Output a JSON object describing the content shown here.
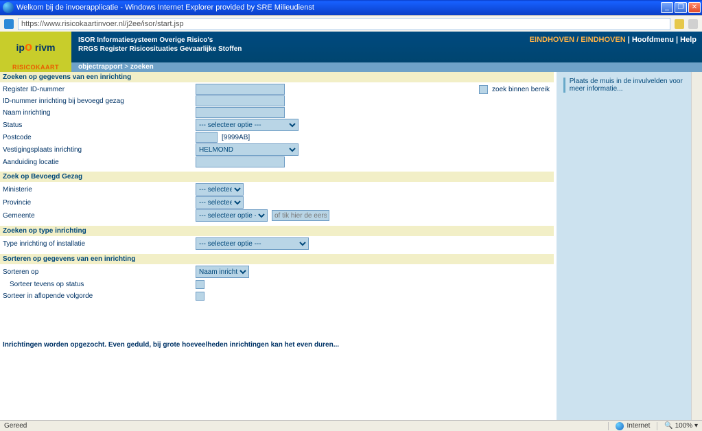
{
  "window": {
    "title": "Welkom bij de invoerapplicatie - Windows Internet Explorer provided by SRE Milieudienst",
    "min": "_",
    "max": "❐",
    "close": "✕"
  },
  "address": {
    "url": "https://www.risicokaartinvoer.nl/j2ee/isor/start.jsp"
  },
  "brand": {
    "line1": "ISOR Informatiesysteem Overige Risico's",
    "line2": "RRGS Register Risicosituaties Gevaarlijke Stoffen",
    "logo_sub": "RISICOKAART",
    "right_user": "EINDHOVEN / EINDHOVEN",
    "menu_main": "Hoofdmenu",
    "menu_help": "Help"
  },
  "crumb": {
    "a": "objectrapport",
    "sep": " > ",
    "b": "zoeken"
  },
  "sections": {
    "s1": "Zoeken op gegevens van een inrichting",
    "s2": "Zoek op Bevoegd Gezag",
    "s3": "Zoeken op type inrichting",
    "s4": "Sorteren op gegevens van een inrichting"
  },
  "labels": {
    "reg_id": "Register ID-nummer",
    "id_bevoegd": "ID-nummer inrichting bij bevoegd gezag",
    "naam": "Naam inrichting",
    "status": "Status",
    "postcode": "Postcode",
    "vestiging": "Vestigingsplaats inrichting",
    "aanduiding": "Aanduiding locatie",
    "ministerie": "Ministerie",
    "provincie": "Provincie",
    "gemeente": "Gemeente",
    "type_inr": "Type inrichting of installatie",
    "sorteren_op": "Sorteren op",
    "sort_status": "Sorteer tevens op status",
    "sort_aflopend": "Sorteer in aflopende volgorde",
    "zoek_bereik": "zoek binnen bereik",
    "postcode_hint": "[9999AB]",
    "gemeente_hint": "of tik hier de eerste letter(s)"
  },
  "options": {
    "select_default": "--- selecteer optie ---",
    "vestiging_val": "HELMOND",
    "sort_val": "Naam inrichting"
  },
  "status_msg": "Inrichtingen worden opgezocht. Even geduld, bij grote hoeveelheden inrichtingen kan het even duren...",
  "help": {
    "text": "Plaats de muis in de invulvelden voor meer informatie..."
  },
  "statusbar": {
    "left": "Gereed",
    "internet": "Internet",
    "zoom": "100%"
  }
}
